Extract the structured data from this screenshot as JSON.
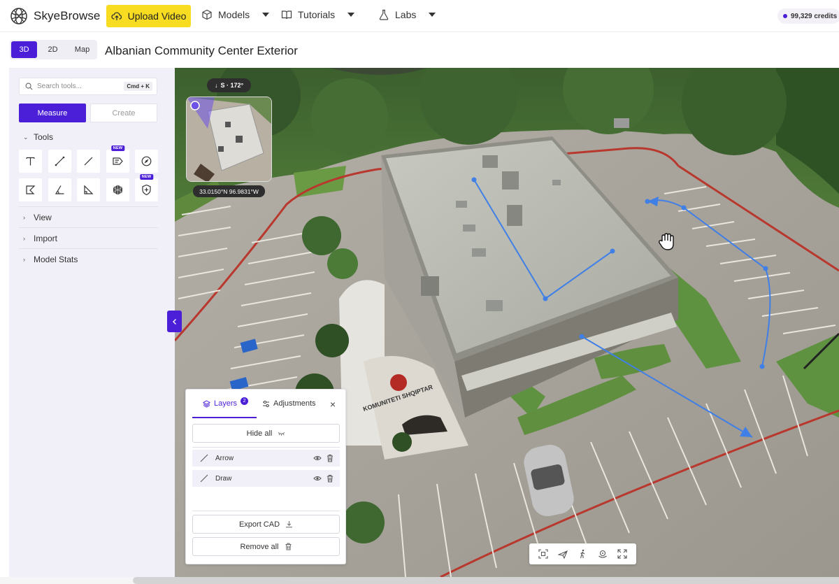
{
  "header": {
    "logo_text": "SkyeBrowse",
    "upload_label": "Upload Video",
    "nav": [
      {
        "label": "Models",
        "icon": "cube-icon"
      },
      {
        "label": "Tutorials",
        "icon": "book-icon"
      },
      {
        "label": "Labs",
        "icon": "flask-icon"
      }
    ],
    "credits": "99,329 credits"
  },
  "viewbar": {
    "modes": [
      "3D",
      "2D",
      "Map"
    ],
    "active_mode": "3D",
    "title": "Albanian Community Center Exterior"
  },
  "sidebar": {
    "search_placeholder": "Search tools...",
    "search_shortcut": "Cmd + K",
    "tabs": {
      "measure": "Measure",
      "create": "Create"
    },
    "sections": {
      "tools": "Tools",
      "view": "View",
      "import": "Import",
      "model_stats": "Model Stats"
    },
    "badge_new": "NEW"
  },
  "scene": {
    "compass": "S · 172°",
    "coords": "33.0150°N 96.9831°W",
    "sign_text": "KOMUNITETI SHQIPTAR",
    "colors": {
      "measure_line": "#3f7fe6",
      "accent": "#4b1fd8",
      "upload": "#f7dc21"
    }
  },
  "layers_panel": {
    "tab_layers": "Layers",
    "layers_count": "2",
    "tab_adjustments": "Adjustments",
    "hide_all": "Hide all",
    "rows": [
      {
        "name": "Arrow"
      },
      {
        "name": "Draw"
      }
    ],
    "export_cad": "Export CAD",
    "remove_all": "Remove all"
  }
}
